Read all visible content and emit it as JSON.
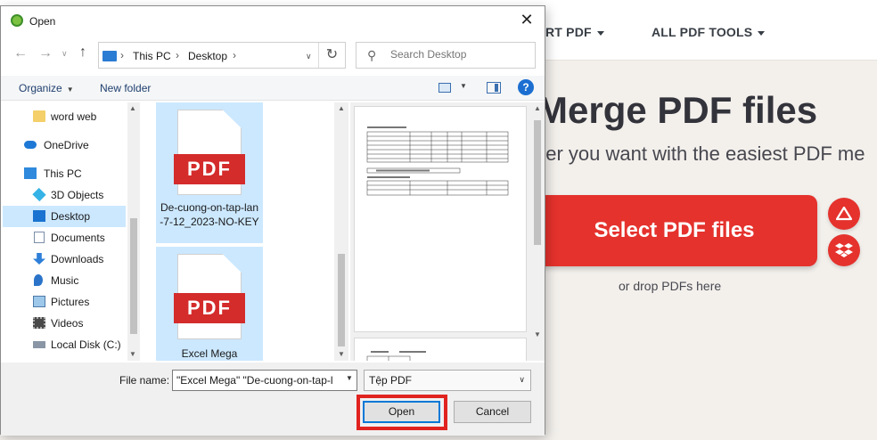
{
  "web": {
    "nav": [
      {
        "label": "RT PDF"
      },
      {
        "label": "ALL PDF TOOLS"
      }
    ],
    "hero_title": "Merge PDF files",
    "hero_subtitle": "der you want with the easiest PDF me",
    "select_button": "Select PDF files",
    "drop_hint": "or drop PDFs here",
    "brand_color": "#e5322d"
  },
  "dialog": {
    "title": "Open",
    "address": {
      "crumbs": [
        "This PC",
        "Desktop"
      ]
    },
    "search": {
      "placeholder": "Search Desktop"
    },
    "commands": {
      "organize": "Organize",
      "new_folder": "New folder"
    },
    "nav_items": [
      {
        "label": "word web",
        "icon": "folder-icon",
        "selected": false
      },
      {
        "label": "OneDrive",
        "icon": "onedrive-icon",
        "selected": false
      },
      {
        "label": "This PC",
        "icon": "computer-icon",
        "selected": false
      },
      {
        "label": "3D Objects",
        "icon": "3d-objects-icon",
        "selected": false
      },
      {
        "label": "Desktop",
        "icon": "desktop-icon",
        "selected": true
      },
      {
        "label": "Documents",
        "icon": "documents-icon",
        "selected": false
      },
      {
        "label": "Downloads",
        "icon": "downloads-icon",
        "selected": false
      },
      {
        "label": "Music",
        "icon": "music-icon",
        "selected": false
      },
      {
        "label": "Pictures",
        "icon": "pictures-icon",
        "selected": false
      },
      {
        "label": "Videos",
        "icon": "videos-icon",
        "selected": false
      },
      {
        "label": "Local Disk (C:)",
        "icon": "local-disk-icon",
        "selected": false
      }
    ],
    "files": [
      {
        "name": "De-cuong-on-tap-lan-7-12_2023-NO-KEY",
        "badge": "PDF",
        "selected": true
      },
      {
        "name": "Excel Mega",
        "badge": "PDF",
        "selected": true
      }
    ],
    "file_name": {
      "label": "File name:",
      "value": "\"Excel Mega\" \"De-cuong-on-tap-l"
    },
    "file_type": {
      "value": "Tệp PDF"
    },
    "buttons": {
      "open": "Open",
      "cancel": "Cancel"
    },
    "highlight_color": "#e0231f"
  }
}
